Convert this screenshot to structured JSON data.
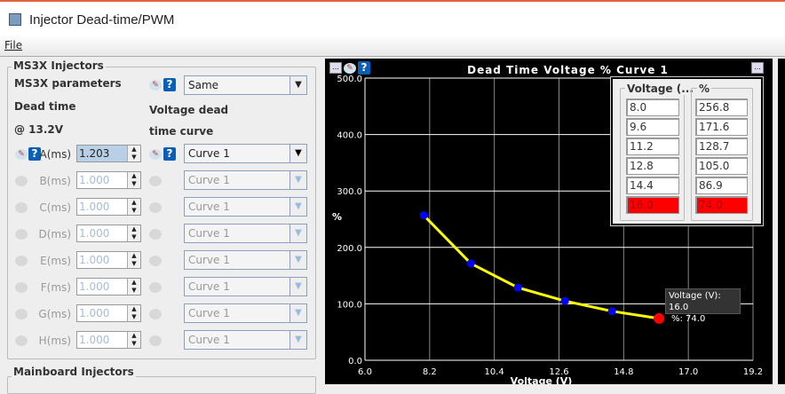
{
  "window": {
    "title": "Injector Dead-time/PWM"
  },
  "menu": {
    "file": "File"
  },
  "ms3x": {
    "group_label": "MS3X Injectors",
    "params_label": "MS3X parameters",
    "params_value": "Same",
    "dead_time_label": "Dead time",
    "at_label": "@ 13.2V",
    "curve_label_1": "Voltage dead",
    "curve_label_2": "time curve",
    "rows": [
      {
        "label": "A(ms)",
        "value": "1.203",
        "curve": "Curve 1"
      },
      {
        "label": "B(ms)",
        "value": "1.000",
        "curve": "Curve 1"
      },
      {
        "label": "C(ms)",
        "value": "1.000",
        "curve": "Curve 1"
      },
      {
        "label": "D(ms)",
        "value": "1.000",
        "curve": "Curve 1"
      },
      {
        "label": "E(ms)",
        "value": "1.000",
        "curve": "Curve 1"
      },
      {
        "label": "F(ms)",
        "value": "1.000",
        "curve": "Curve 1"
      },
      {
        "label": "G(ms)",
        "value": "1.000",
        "curve": "Curve 1"
      },
      {
        "label": "H(ms)",
        "value": "1.000",
        "curve": "Curve 1"
      }
    ]
  },
  "mainboard": {
    "group_label": "Mainboard Injectors"
  },
  "table": {
    "col1": "Voltage (...",
    "col2": "%"
  },
  "tooltip": {
    "line1": "Voltage (V): 16.0",
    "line2": "%: 74.0"
  },
  "chart_data": {
    "type": "line",
    "title": "Dead Time Voltage % Curve 1",
    "xlabel": "Voltage (V)",
    "ylabel": "%",
    "x": [
      8.0,
      9.6,
      11.2,
      12.8,
      14.4,
      16.0
    ],
    "y": [
      256.8,
      171.6,
      128.7,
      105.0,
      86.9,
      74.0
    ],
    "xlim": [
      6.0,
      19.2
    ],
    "ylim": [
      0,
      500
    ],
    "xticks": [
      "6.0",
      "8.2",
      "10.4",
      "12.6",
      "14.8",
      "17.0",
      "19.2"
    ],
    "yticks": [
      "0.0",
      "100.0",
      "200.0",
      "300.0",
      "400.0",
      "500.0"
    ],
    "selected_index": 5,
    "line_color": "#ffff00",
    "point_color": "#0000ff",
    "selected_color": "#ff0000"
  }
}
